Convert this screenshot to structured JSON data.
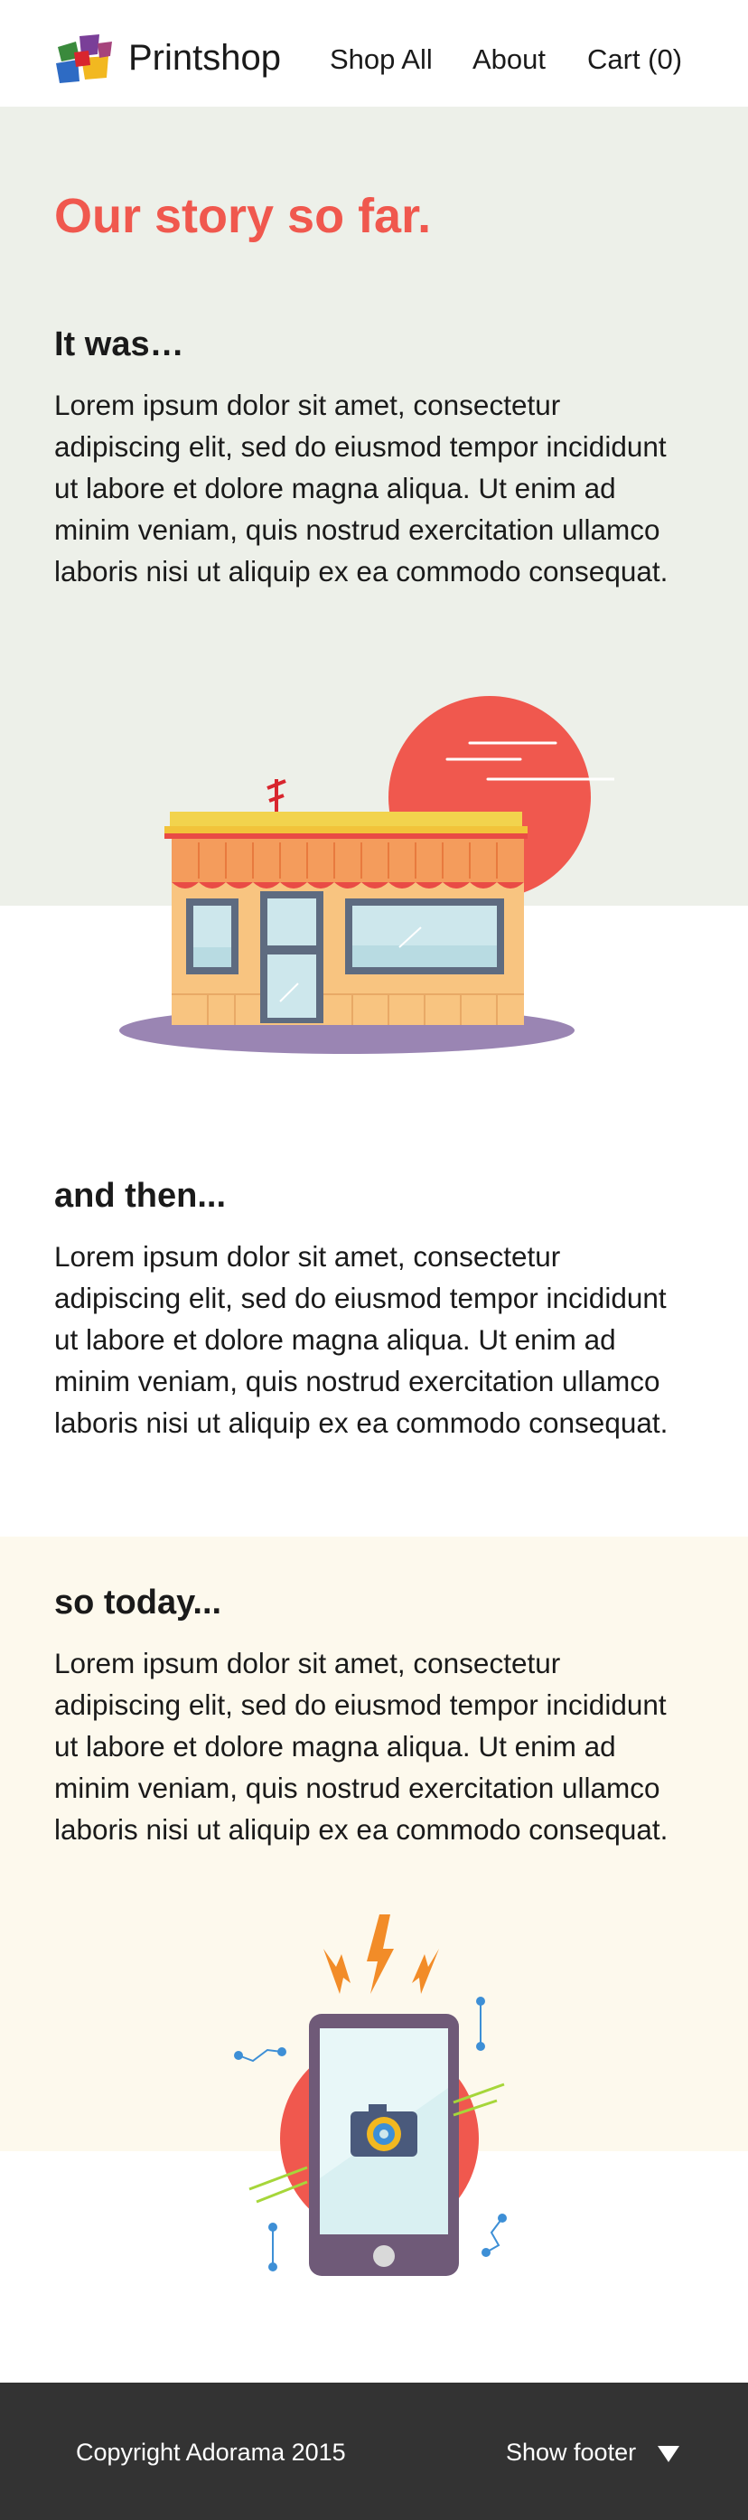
{
  "header": {
    "brand": "Printshop",
    "nav": [
      {
        "label": "Shop All"
      },
      {
        "label": "About"
      },
      {
        "label": "Cart (0)"
      }
    ]
  },
  "story": {
    "headline": "Our story so far.",
    "sections": [
      {
        "heading": "It was…",
        "body": "Lorem ipsum dolor sit amet, consectetur adipiscing elit, sed do eiusmod tempor incididunt ut labore et dolore magna aliqua. Ut enim ad minim veniam, quis nostrud exercitation ullamco laboris nisi ut aliquip ex ea commodo consequat."
      },
      {
        "heading": "and then...",
        "body": "Lorem ipsum dolor sit amet, consectetur adipiscing elit, sed do eiusmod tempor incididunt ut labore et dolore magna aliqua. Ut enim ad minim veniam, quis nostrud exercitation ullamco laboris nisi ut aliquip ex ea commodo consequat."
      },
      {
        "heading": "so today...",
        "body": "Lorem ipsum dolor sit amet, consectetur adipiscing elit, sed do eiusmod tempor incididunt ut labore et dolore magna aliqua. Ut enim ad minim veniam, quis nostrud exercitation ullamco laboris nisi ut aliquip ex ea commodo consequat."
      }
    ]
  },
  "illustrations": {
    "shop": "storefront-illustration",
    "phone": "phone-camera-illustration"
  },
  "footer": {
    "copyright": "Copyright Adorama 2015",
    "toggle_label": "Show footer",
    "toggle_icon": "triangle-down-icon"
  },
  "colors": {
    "accent": "#f0584e",
    "section1_bg": "#edf0e9",
    "section3_bg": "#fdf9ed",
    "footer_bg": "#333333"
  }
}
